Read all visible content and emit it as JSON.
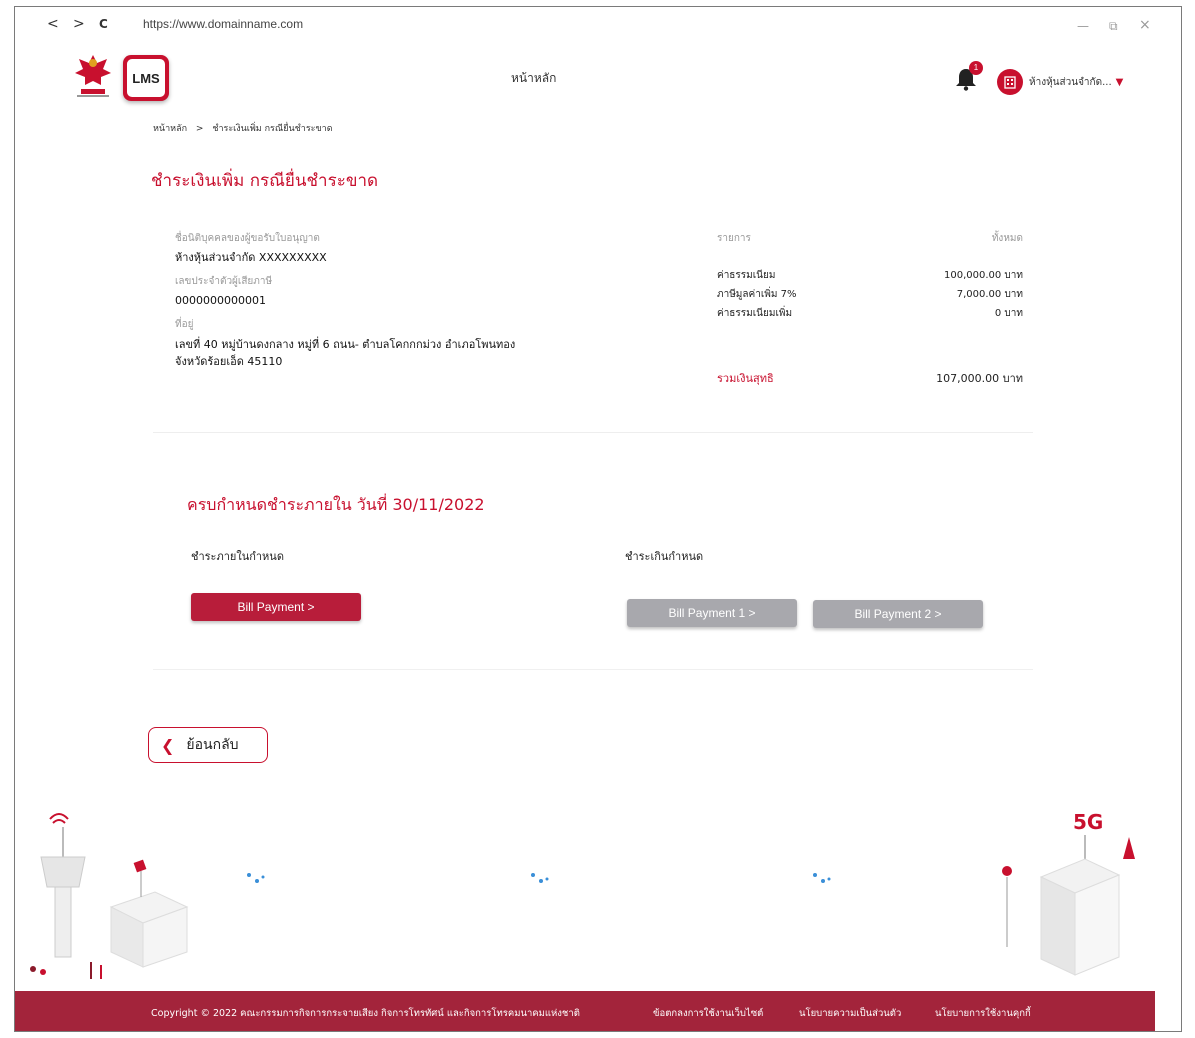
{
  "browser": {
    "back": "<",
    "forward": ">",
    "reload": "C",
    "url": "https://www.domainname.com",
    "minimize": "—",
    "restore": "⧉",
    "close": "×"
  },
  "header": {
    "logo_text": "LMS",
    "nav_home": "หน้าหลัก",
    "notification_count": "1",
    "account_name": "ห้างหุ้นส่วนจำกัด..."
  },
  "breadcrumb": [
    "หน้าหลัก",
    ">",
    "ชำระเงินเพิ่ม กรณียื่นชำระขาด"
  ],
  "page_title": "ชำระเงินเพิ่ม กรณียื่นชำระขาด",
  "licensee": {
    "name_label": "ชื่อนิติบุคคลของผู้ขอรับใบอนุญาต",
    "name_value": "ห้างหุ้นส่วนจำกัด XXXXXXXXX",
    "tax_label": "เลขประจำตัวผู้เสียภาษี",
    "tax_value": "0000000000001",
    "address_label": "ที่อยู่",
    "address_line1": "เลขที่ 40 หมู่บ้านดงกลาง หมู่ที่ 6 ถนน- ตำบลโคกกกม่วง อำเภอโพนทอง",
    "address_line2": "จังหวัดร้อยเอ็ด 45110"
  },
  "fees": {
    "col_item": "รายการ",
    "col_total": "ทั้งหมด",
    "rows": [
      {
        "label": "ค่าธรรมเนียม",
        "amount": "100,000.00 บาท"
      },
      {
        "label": "ภาษีมูลค่าเพิ่ม 7%",
        "amount": "7,000.00 บาท"
      },
      {
        "label": "ค่าธรรมเนียมเพิ่ม",
        "amount": "0 บาท"
      }
    ],
    "total_label": "รวมเงินสุทธิ",
    "total_amount": "107,000.00 บาท"
  },
  "payment": {
    "due_title": "ครบกำหนดชำระภายใน วันที่  30/11/2022",
    "within_label": "ชำระภายในกำหนด",
    "overdue_label": "ชำระเกินกำหนด",
    "bill_payment": "Bill Payment >",
    "bill_payment_1": "Bill Payment 1 >",
    "bill_payment_2": "Bill Payment 2 >"
  },
  "back_button": "ย้อนกลับ",
  "illustration": {
    "label_5g": "5G"
  },
  "footer": {
    "copyright": "Copyright © 2022 คณะกรรมการกิจการกระจายเสียง กิจการโทรทัศน์ และกิจการโทรคมนาคมแห่งชาติ",
    "terms": "ข้อตกลงการใช้งานเว็บไซต์",
    "privacy": "นโยบายความเป็นส่วนตัว",
    "cookies": "นโยบายการใช้งานคุกกี้"
  },
  "colors": {
    "brand_red": "#c8102e",
    "footer_red": "#a3243b",
    "button_gray": "#a8a8ad"
  }
}
